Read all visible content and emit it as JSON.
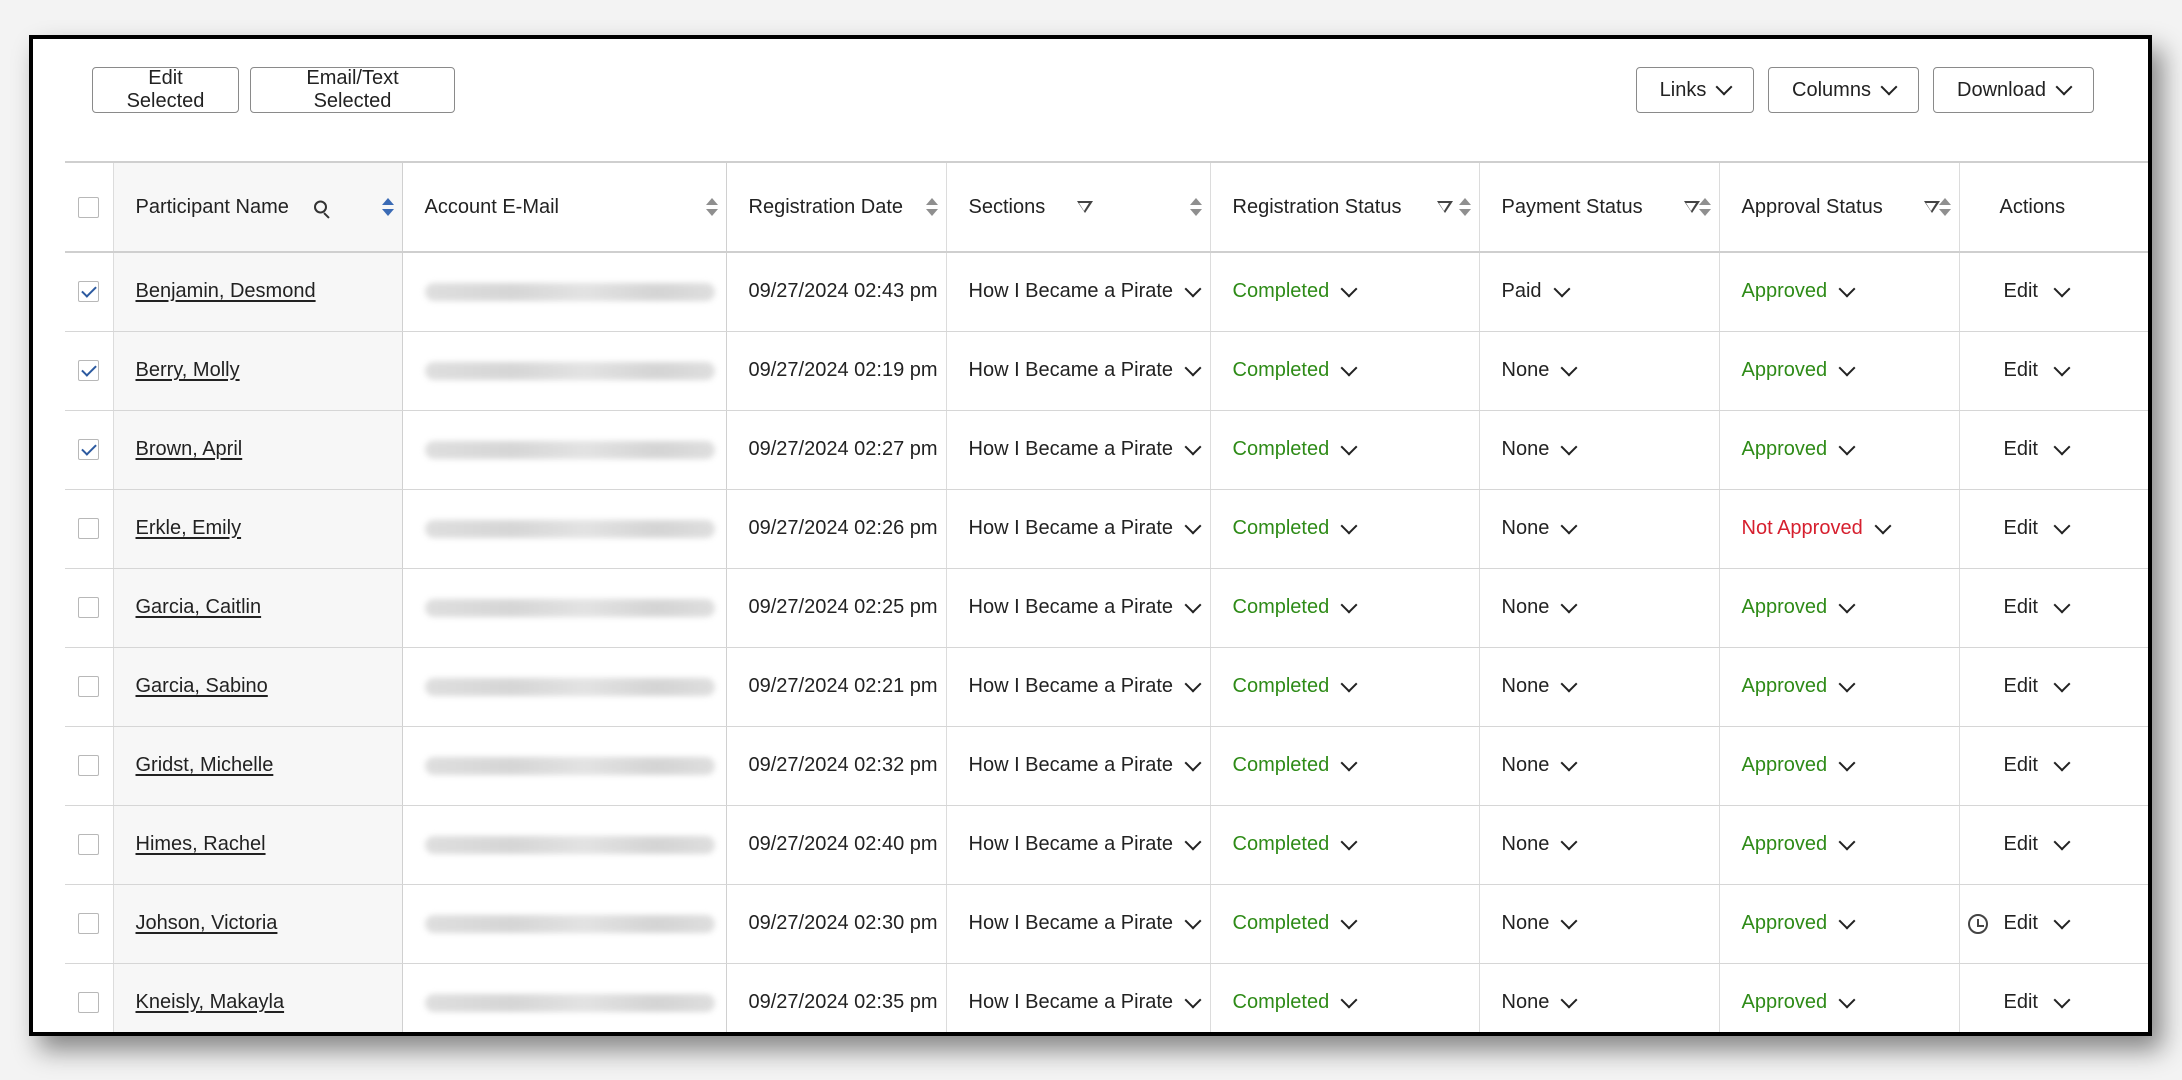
{
  "toolbar": {
    "edit_selected": "Edit Selected",
    "email_text_selected": "Email/Text Selected",
    "links": "Links",
    "columns": "Columns",
    "download": "Download"
  },
  "columns": {
    "participant_name": "Participant Name",
    "account_email": "Account E-Mail",
    "registration_date": "Registration Date",
    "sections": "Sections",
    "registration_status": "Registration Status",
    "payment_status": "Payment Status",
    "approval_status": "Approval Status",
    "actions": "Actions"
  },
  "colors": {
    "approved": "#2e8b17",
    "not_approved": "#d61f2e",
    "checkbox_check": "#2c5aa0"
  },
  "rows": [
    {
      "checked": true,
      "name": "Benjamin, Desmond",
      "date": "09/27/2024 02:43 pm",
      "section": "How I Became a Pirate",
      "reg_status": "Completed",
      "payment": "Paid",
      "approval": "Approved",
      "action": "Edit",
      "history": false
    },
    {
      "checked": true,
      "name": "Berry, Molly",
      "date": "09/27/2024 02:19 pm",
      "section": "How I Became a Pirate",
      "reg_status": "Completed",
      "payment": "None",
      "approval": "Approved",
      "action": "Edit",
      "history": false
    },
    {
      "checked": true,
      "name": "Brown, April",
      "date": "09/27/2024 02:27 pm",
      "section": "How I Became a Pirate",
      "reg_status": "Completed",
      "payment": "None",
      "approval": "Approved",
      "action": "Edit",
      "history": false
    },
    {
      "checked": false,
      "name": "Erkle, Emily",
      "date": "09/27/2024 02:26 pm",
      "section": "How I Became a Pirate",
      "reg_status": "Completed",
      "payment": "None",
      "approval": "Not Approved",
      "action": "Edit",
      "history": false
    },
    {
      "checked": false,
      "name": "Garcia, Caitlin",
      "date": "09/27/2024 02:25 pm",
      "section": "How I Became a Pirate",
      "reg_status": "Completed",
      "payment": "None",
      "approval": "Approved",
      "action": "Edit",
      "history": false
    },
    {
      "checked": false,
      "name": "Garcia, Sabino",
      "date": "09/27/2024 02:21 pm",
      "section": "How I Became a Pirate",
      "reg_status": "Completed",
      "payment": "None",
      "approval": "Approved",
      "action": "Edit",
      "history": false
    },
    {
      "checked": false,
      "name": "Gridst, Michelle",
      "date": "09/27/2024 02:32 pm",
      "section": "How I Became a Pirate",
      "reg_status": "Completed",
      "payment": "None",
      "approval": "Approved",
      "action": "Edit",
      "history": false
    },
    {
      "checked": false,
      "name": "Himes, Rachel",
      "date": "09/27/2024 02:40 pm",
      "section": "How I Became a Pirate",
      "reg_status": "Completed",
      "payment": "None",
      "approval": "Approved",
      "action": "Edit",
      "history": false
    },
    {
      "checked": false,
      "name": "Johson, Victoria",
      "date": "09/27/2024 02:30 pm",
      "section": "How I Became a Pirate",
      "reg_status": "Completed",
      "payment": "None",
      "approval": "Approved",
      "action": "Edit",
      "history": true
    },
    {
      "checked": false,
      "name": "Kneisly, Makayla",
      "date": "09/27/2024 02:35 pm",
      "section": "How I Became a Pirate",
      "reg_status": "Completed",
      "payment": "None",
      "approval": "Approved",
      "action": "Edit",
      "history": false
    }
  ]
}
